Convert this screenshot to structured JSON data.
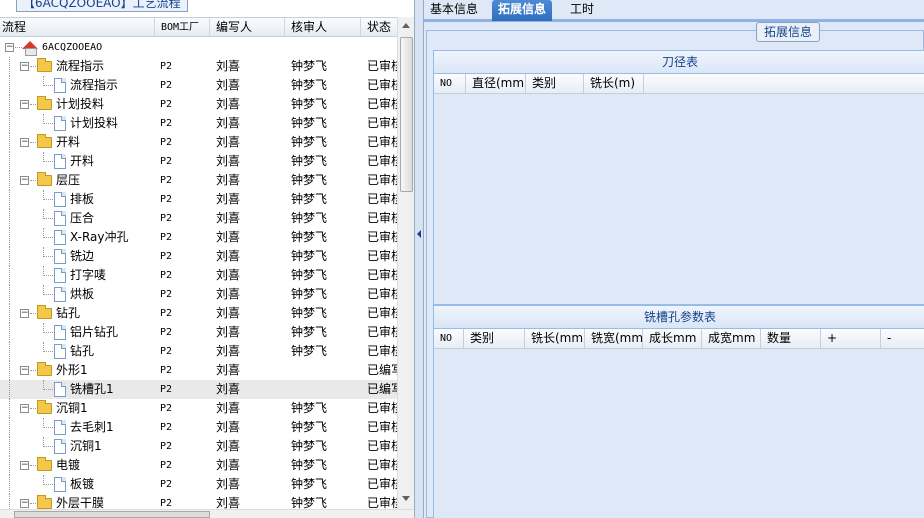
{
  "left_title": "【6ACQZOOEAO】工艺流程",
  "tree_columns": {
    "flow": "流程",
    "bom": "BOM工厂",
    "author": "编写人",
    "reviewer": "核审人",
    "status": "状态"
  },
  "root": {
    "label": "6ACQZOOEAO"
  },
  "tree_rows": [
    {
      "label": "流程指示",
      "type": "folder",
      "level": 1,
      "bom": "P2",
      "author": "刘喜",
      "reviewer": "钟梦飞",
      "status": "已审核"
    },
    {
      "label": "流程指示",
      "type": "doc",
      "level": 2,
      "bom": "P2",
      "author": "刘喜",
      "reviewer": "钟梦飞",
      "status": "已审核"
    },
    {
      "label": "计划投料",
      "type": "folder",
      "level": 1,
      "bom": "P2",
      "author": "刘喜",
      "reviewer": "钟梦飞",
      "status": "已审核"
    },
    {
      "label": "计划投料",
      "type": "doc",
      "level": 2,
      "bom": "P2",
      "author": "刘喜",
      "reviewer": "钟梦飞",
      "status": "已审核"
    },
    {
      "label": "开料",
      "type": "folder",
      "level": 1,
      "bom": "P2",
      "author": "刘喜",
      "reviewer": "钟梦飞",
      "status": "已审核"
    },
    {
      "label": "开料",
      "type": "doc",
      "level": 2,
      "bom": "P2",
      "author": "刘喜",
      "reviewer": "钟梦飞",
      "status": "已审核"
    },
    {
      "label": "层压",
      "type": "folder",
      "level": 1,
      "bom": "P2",
      "author": "刘喜",
      "reviewer": "钟梦飞",
      "status": "已审核"
    },
    {
      "label": "排板",
      "type": "doc",
      "level": 2,
      "bom": "P2",
      "author": "刘喜",
      "reviewer": "钟梦飞",
      "status": "已审核"
    },
    {
      "label": "压合",
      "type": "doc",
      "level": 2,
      "bom": "P2",
      "author": "刘喜",
      "reviewer": "钟梦飞",
      "status": "已审核"
    },
    {
      "label": "X-Ray冲孔",
      "type": "doc",
      "level": 2,
      "bom": "P2",
      "author": "刘喜",
      "reviewer": "钟梦飞",
      "status": "已审核"
    },
    {
      "label": "铣边",
      "type": "doc",
      "level": 2,
      "bom": "P2",
      "author": "刘喜",
      "reviewer": "钟梦飞",
      "status": "已审核"
    },
    {
      "label": "打字唛",
      "type": "doc",
      "level": 2,
      "bom": "P2",
      "author": "刘喜",
      "reviewer": "钟梦飞",
      "status": "已审核"
    },
    {
      "label": "烘板",
      "type": "doc",
      "level": 2,
      "bom": "P2",
      "author": "刘喜",
      "reviewer": "钟梦飞",
      "status": "已审核"
    },
    {
      "label": "钻孔",
      "type": "folder",
      "level": 1,
      "bom": "P2",
      "author": "刘喜",
      "reviewer": "钟梦飞",
      "status": "已审核"
    },
    {
      "label": "铝片钻孔",
      "type": "doc",
      "level": 2,
      "bom": "P2",
      "author": "刘喜",
      "reviewer": "钟梦飞",
      "status": "已审核"
    },
    {
      "label": "钻孔",
      "type": "doc",
      "level": 2,
      "bom": "P2",
      "author": "刘喜",
      "reviewer": "钟梦飞",
      "status": "已审核"
    },
    {
      "label": "外形1",
      "type": "folder",
      "level": 1,
      "bom": "P2",
      "author": "刘喜",
      "reviewer": "",
      "status": "已编写"
    },
    {
      "label": "铣槽孔1",
      "type": "doc",
      "level": 2,
      "bom": "P2",
      "author": "刘喜",
      "reviewer": "",
      "status": "已编写",
      "selected": true
    },
    {
      "label": "沉铜1",
      "type": "folder",
      "level": 1,
      "bom": "P2",
      "author": "刘喜",
      "reviewer": "钟梦飞",
      "status": "已审核"
    },
    {
      "label": "去毛刺1",
      "type": "doc",
      "level": 2,
      "bom": "P2",
      "author": "刘喜",
      "reviewer": "钟梦飞",
      "status": "已审核"
    },
    {
      "label": "沉铜1",
      "type": "doc",
      "level": 2,
      "bom": "P2",
      "author": "刘喜",
      "reviewer": "钟梦飞",
      "status": "已审核"
    },
    {
      "label": "电镀",
      "type": "folder",
      "level": 1,
      "bom": "P2",
      "author": "刘喜",
      "reviewer": "钟梦飞",
      "status": "已审核"
    },
    {
      "label": "板镀",
      "type": "doc",
      "level": 2,
      "bom": "P2",
      "author": "刘喜",
      "reviewer": "钟梦飞",
      "status": "已审核"
    },
    {
      "label": "外层干膜",
      "type": "folder",
      "level": 1,
      "bom": "P2",
      "author": "刘喜",
      "reviewer": "钟梦飞",
      "status": "已审核"
    }
  ],
  "tabs": [
    {
      "label": "基本信息",
      "active": false
    },
    {
      "label": "拓展信息",
      "active": true
    },
    {
      "label": "工时",
      "active": false
    }
  ],
  "group_title": "拓展信息",
  "tool_table": {
    "title": "刀径表",
    "columns": [
      "NO",
      "直径(mm)",
      "类别",
      "铣长(m)"
    ]
  },
  "slot_table": {
    "title": "铣槽孔参数表",
    "columns": [
      "NO",
      "类别",
      "铣长(mm)",
      "铣宽(mm)",
      "成长mm",
      "成宽mm",
      "数量",
      "+",
      "-"
    ]
  },
  "colors": {
    "accent": "#3b7dd0",
    "panel_bg": "#dfe8f6",
    "border": "#99bbe8",
    "title_text": "#15428b"
  }
}
